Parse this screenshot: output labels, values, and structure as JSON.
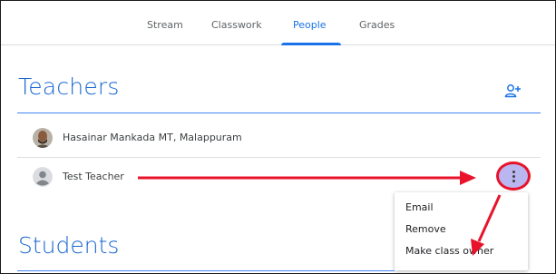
{
  "nav": {
    "tabs": [
      {
        "label": "Stream"
      },
      {
        "label": "Classwork"
      },
      {
        "label": "People"
      },
      {
        "label": "Grades"
      }
    ],
    "active_tab": "People"
  },
  "teachers": {
    "title": "Teachers",
    "add_icon": "add-person-icon",
    "list": [
      {
        "name": "Hasainar Mankada MT, Malappuram",
        "avatar": "photo"
      },
      {
        "name": "Test Teacher",
        "avatar": "default-person"
      }
    ]
  },
  "menu": {
    "items": [
      {
        "label": "Email"
      },
      {
        "label": "Remove"
      },
      {
        "label": "Make class owner"
      }
    ]
  },
  "students": {
    "title": "Students"
  },
  "colors": {
    "accent": "#1a73e8",
    "heading": "#1967d2",
    "annotation": "#e8132b",
    "kebab_highlight": "#b9b6f0"
  }
}
